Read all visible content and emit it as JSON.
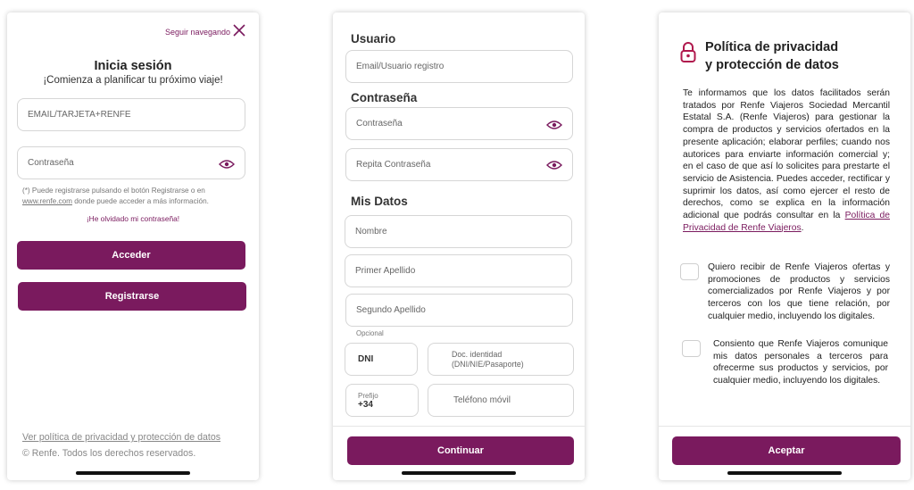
{
  "colors": {
    "brand": "#7a1a5e",
    "border": "#d6d6d6",
    "muted": "#777777"
  },
  "login": {
    "top_link": "Seguir navegando",
    "title": "Inicia sesión",
    "subtitle": "¡Comienza a planificar tu próximo viaje!",
    "email_placeholder": "EMAIL/TARJETA+RENFE",
    "password_placeholder": "Contraseña",
    "note_part1": "(*) Puede registrarse pulsando el botón Registrarse o en",
    "note_link": "www.renfe.com",
    "note_part2": " donde puede acceder a más información.",
    "forgot": "¡He olvidado mi contraseña!",
    "login_button": "Acceder",
    "register_button": "Registrarse",
    "privacy_link": "Ver política de privacidad y protección de datos",
    "copyright": "©   Renfe. Todos los derechos reservados."
  },
  "register": {
    "user_heading": "Usuario",
    "user_placeholder": "Email/Usuario registro",
    "password_heading": "Contraseña",
    "password_placeholder": "Contraseña",
    "repeat_password_placeholder": "Repita  Contraseña",
    "mydata_heading": "Mis Datos",
    "name_placeholder": "Nombre",
    "surname1_placeholder": "Primer Apellido",
    "surname2_placeholder": "Segundo Apellido",
    "optional_label": "Opcional",
    "doc_type": "DNI",
    "doc_placeholder_line1": "Doc. identidad",
    "doc_placeholder_line2": "(DNI/NIE/Pasaporte)",
    "prefix_label": "Prefijo",
    "prefix_value": "+34",
    "phone_placeholder": "Teléfono móvil",
    "continue_button": "Continuar"
  },
  "privacy": {
    "title_line1": "Política de privacidad",
    "title_line2": "y protección de datos",
    "body": "Te informamos que los datos facilitados serán tratados por Renfe Viajeros Sociedad Mercantil Estatal S.A. (Renfe Viajeros) para gestionar la compra de productos y servicios ofertados en la presente aplicación; elaborar perfiles; cuando nos autorices para enviarte información comercial y; en el caso de que así lo solicites para prestarte el servicio de Asistencia. Puedes acceder, rectificar y suprimir los datos, así como ejercer el resto de derechos, como se explica en la información adicional que podrás consultar en la ",
    "body_link": "Política de Privacidad de Renfe Viajeros",
    "body_end": ".",
    "consent1": "Quiero recibir de Renfe Viajeros ofertas y promociones de productos y servicios comercializados por Renfe Viajeros y por terceros con los que tiene relación, por cualquier medio, incluyendo los digitales.",
    "consent2": "Consiento que Renfe Viajeros comunique mis datos personales a terceros para ofrecerme sus productos y servicios, por cualquier medio, incluyendo los digitales.",
    "accept_button": "Aceptar"
  }
}
